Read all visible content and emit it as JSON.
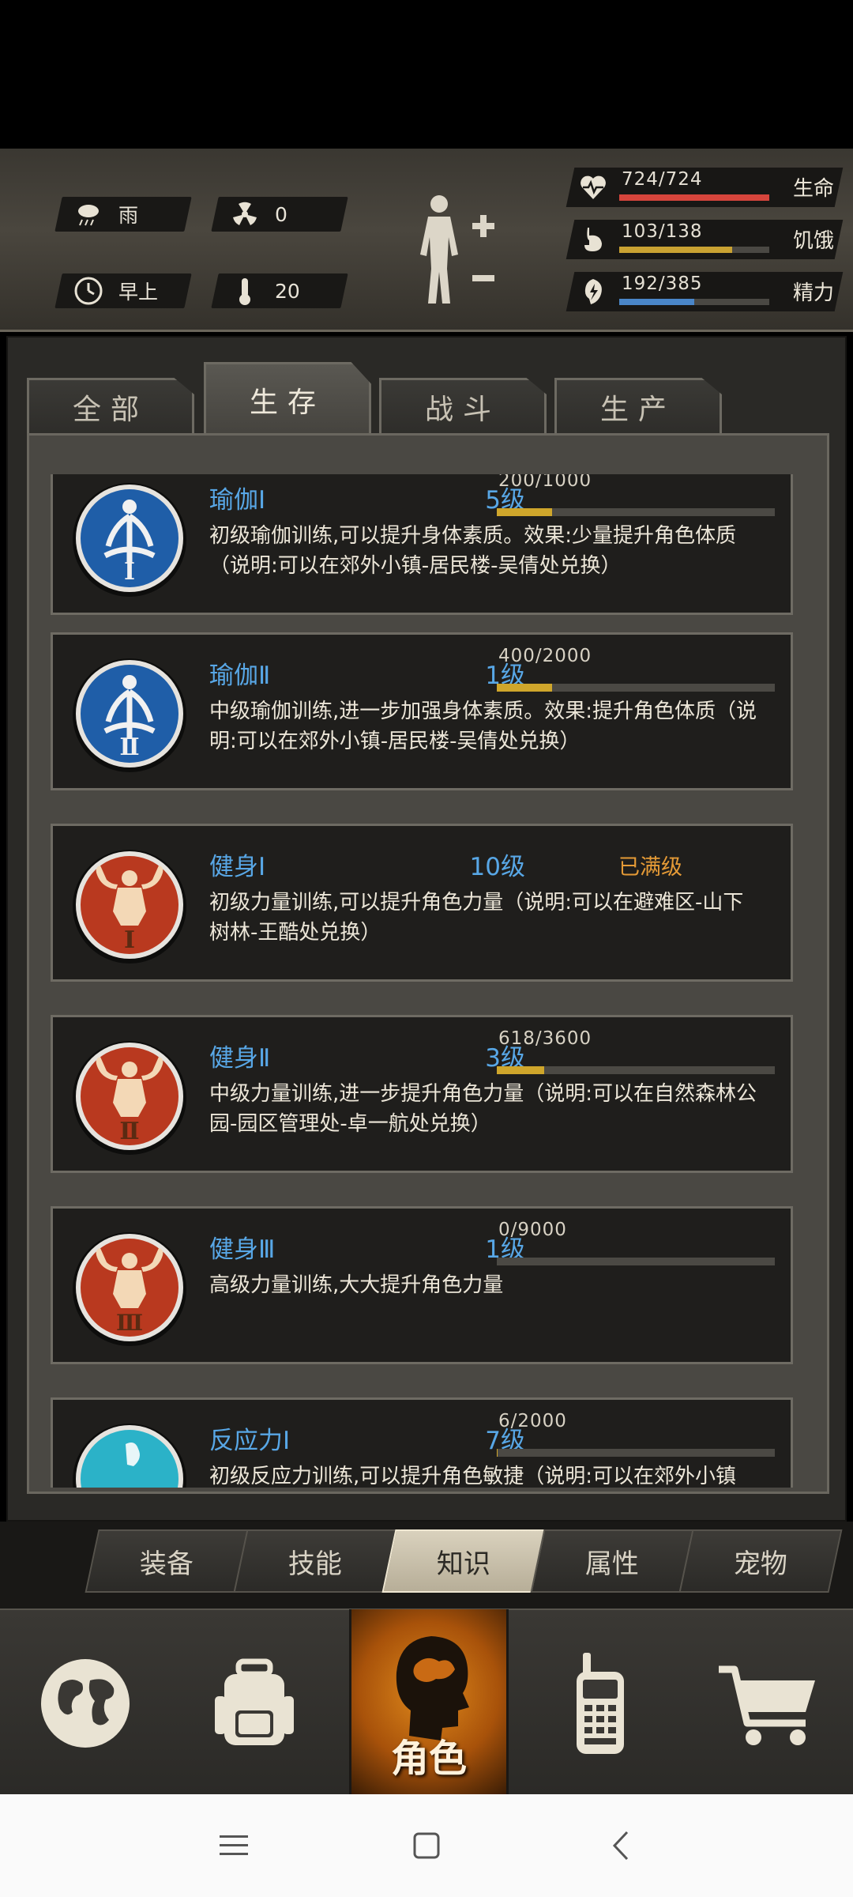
{
  "status": {
    "weather": "雨",
    "radiation": "0",
    "time_of_day": "早上",
    "temperature": "20",
    "stats": [
      {
        "value": "724/724",
        "label": "生命",
        "fill": 1.0,
        "color": "#d6453c",
        "icon": "heart-pulse-icon"
      },
      {
        "value": "103/138",
        "label": "饥饿",
        "fill": 0.75,
        "color": "#c9a232",
        "icon": "stomach-icon"
      },
      {
        "value": "192/385",
        "label": "精力",
        "fill": 0.5,
        "color": "#4a86c8",
        "icon": "energy-icon"
      }
    ]
  },
  "tabs": [
    {
      "label": "全部",
      "active": false
    },
    {
      "label": "生存",
      "active": true
    },
    {
      "label": "战斗",
      "active": false
    },
    {
      "label": "生产",
      "active": false
    }
  ],
  "skills": [
    {
      "name": "瑜伽Ⅰ",
      "level": "5级",
      "xp": "200/1000",
      "fill": 0.2,
      "maxed_label": "",
      "desc": "初级瑜伽训练,可以提升身体素质。效果:少量提升角色体质（说明:可以在郊外小镇-居民楼-吴倩处兑换）",
      "icon": "yoga-icon",
      "numeral": "Ⅰ"
    },
    {
      "name": "瑜伽Ⅱ",
      "level": "1级",
      "xp": "400/2000",
      "fill": 0.2,
      "maxed_label": "",
      "desc": "中级瑜伽训练,进一步加强身体素质。效果:提升角色体质（说明:可以在郊外小镇-居民楼-吴倩处兑换）",
      "icon": "yoga-icon",
      "numeral": "Ⅱ"
    },
    {
      "name": "健身Ⅰ",
      "level": "10级",
      "xp": "",
      "fill": 0,
      "maxed_label": "已满级",
      "desc": "初级力量训练,可以提升角色力量（说明:可以在避难区-山下树林-王酷处兑换）",
      "icon": "muscle-icon",
      "numeral": "Ⅰ"
    },
    {
      "name": "健身Ⅱ",
      "level": "3级",
      "xp": "618/3600",
      "fill": 0.17,
      "maxed_label": "",
      "desc": "中级力量训练,进一步提升角色力量（说明:可以在自然森林公园-园区管理处-卓一航处兑换）",
      "icon": "muscle-icon",
      "numeral": "Ⅱ"
    },
    {
      "name": "健身Ⅲ",
      "level": "1级",
      "xp": "0/9000",
      "fill": 0,
      "maxed_label": "",
      "desc": "高级力量训练,大大提升角色力量",
      "icon": "muscle-icon",
      "numeral": "Ⅲ"
    },
    {
      "name": "反应力Ⅰ",
      "level": "7级",
      "xp": "6/2000",
      "fill": 0.003,
      "maxed_label": "",
      "desc": "初级反应力训练,可以提升角色敏捷（说明:可以在郊外小镇",
      "icon": "reflex-icon",
      "numeral": "Ⅰ"
    }
  ],
  "subtabs": [
    {
      "label": "装备",
      "active": false
    },
    {
      "label": "技能",
      "active": false
    },
    {
      "label": "知识",
      "active": true
    },
    {
      "label": "属性",
      "active": false
    },
    {
      "label": "宠物",
      "active": false
    }
  ],
  "nav": {
    "center_label": "角色",
    "items": [
      "globe-icon",
      "backpack-icon",
      "character-icon",
      "radio-icon",
      "shopping-cart-icon"
    ]
  }
}
